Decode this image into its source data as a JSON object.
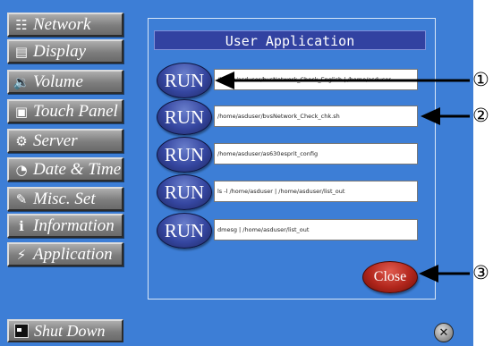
{
  "sidebar": {
    "items": [
      {
        "label": "Network",
        "icon": "network-icon",
        "glyph": "☷"
      },
      {
        "label": "Display",
        "icon": "display-icon",
        "glyph": "▤"
      },
      {
        "label": "Volume",
        "icon": "speaker-icon",
        "glyph": "🔉"
      },
      {
        "label": "Touch Panel",
        "icon": "touch-panel-icon",
        "glyph": "▣"
      },
      {
        "label": "Server",
        "icon": "server-icon",
        "glyph": "⚙"
      },
      {
        "label": "Date & Time",
        "icon": "clock-icon",
        "glyph": "◔"
      },
      {
        "label": "Misc. Set",
        "icon": "pencil-icon",
        "glyph": "✎"
      },
      {
        "label": "Information",
        "icon": "info-icon",
        "glyph": "ℹ"
      },
      {
        "label": "Application",
        "icon": "lightning-icon",
        "glyph": "⚡"
      }
    ],
    "shutdown_label": "Shut Down"
  },
  "panel": {
    "title": "User Application",
    "run_label": "RUN",
    "commands": [
      "/home/asduser/bvsNetwork_Check_English | /home/asduser",
      "/home/asduser/bvsNetwork_Check_chk.sh",
      "/home/asduser/as630esprit_config",
      "ls -l /home/asduser | /home/asduser/list_out",
      "dmesg | /home/asduser/list_out"
    ],
    "close_label": "Close"
  },
  "close_icon_glyph": "✕",
  "callouts": [
    "①",
    "②",
    "③"
  ]
}
